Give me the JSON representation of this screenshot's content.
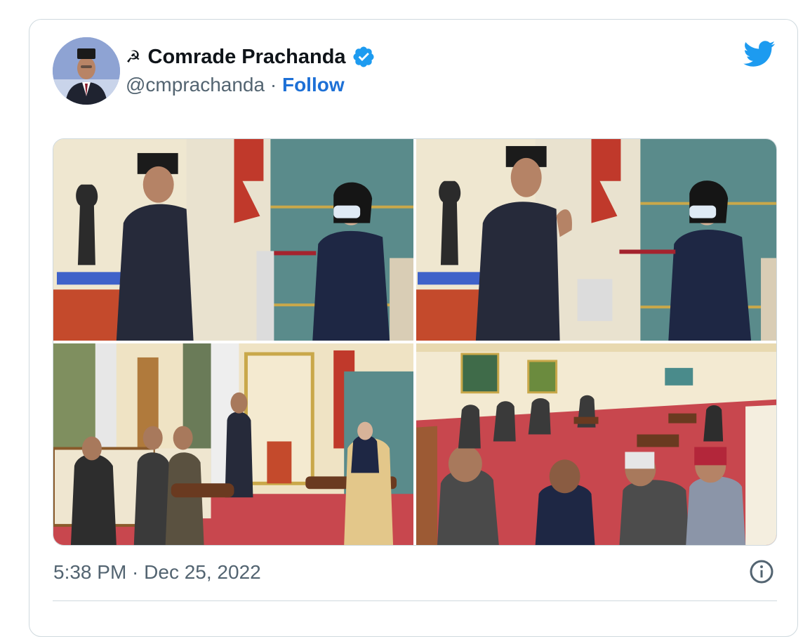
{
  "author": {
    "emoji": "☭",
    "display_name": "Comrade Prachanda",
    "handle": "@cmprachanda",
    "separator": " · ",
    "follow_label": "Follow",
    "verified": true
  },
  "colors": {
    "verified_blue": "#1d9bf0",
    "follow_blue": "#1d70d6",
    "twitter_blue": "#1d9bf0",
    "muted_text": "#536471"
  },
  "media": {
    "count": 4
  },
  "footer": {
    "timestamp": "5:38 PM · Dec 25, 2022"
  },
  "icons": {
    "verified": "verified-badge-icon",
    "brand": "twitter-bird-icon",
    "info": "info-circle-icon"
  }
}
